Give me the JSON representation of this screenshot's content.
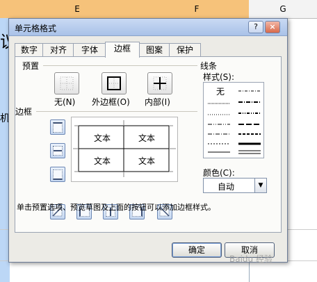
{
  "spreadsheet": {
    "columns": [
      {
        "label": "E"
      },
      {
        "label": "F"
      },
      {
        "label": "G"
      }
    ],
    "partial_chars": [
      "议",
      "机"
    ]
  },
  "dialog": {
    "title": "单元格格式",
    "help_btn": "?",
    "close_btn": "×",
    "tabs": [
      "数字",
      "对齐",
      "字体",
      "边框",
      "图案",
      "保护"
    ],
    "active_tab": "边框",
    "presets": {
      "label": "预置",
      "none": "无(N)",
      "outline": "外边框(O)",
      "inside": "内部(I)"
    },
    "border_label": "边框",
    "preview_text": [
      "文本",
      "文本",
      "文本",
      "文本"
    ],
    "line": {
      "label": "线条",
      "style_label": "样式(S):",
      "none_label": "无"
    },
    "color": {
      "label": "颜色(C):",
      "value": "自动"
    },
    "hint": "单击预置选项、预览草图及上面的按钮可以添加边框样式。",
    "ok": "确定",
    "cancel": "取消",
    "watermark": "Baidu 经验"
  }
}
